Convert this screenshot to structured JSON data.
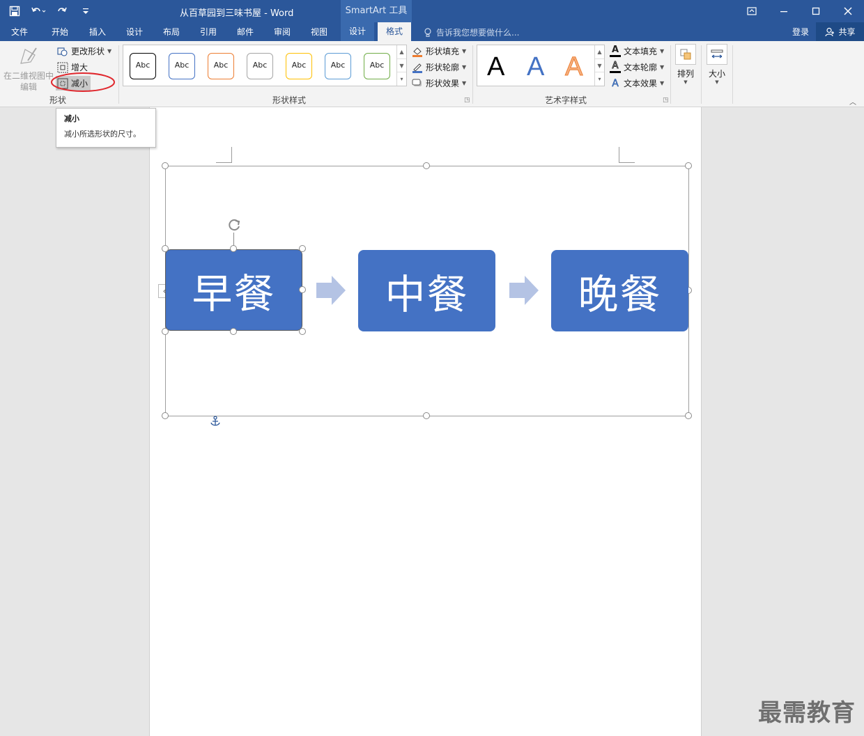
{
  "window": {
    "title": "从百草园到三味书屋 - Word",
    "context_tab_title": "SmartArt 工具"
  },
  "tabs": [
    {
      "label": "文件"
    },
    {
      "label": "开始"
    },
    {
      "label": "插入"
    },
    {
      "label": "设计"
    },
    {
      "label": "布局"
    },
    {
      "label": "引用"
    },
    {
      "label": "邮件"
    },
    {
      "label": "审阅"
    },
    {
      "label": "视图"
    },
    {
      "label": "设计"
    },
    {
      "label": "格式"
    }
  ],
  "tell_me": "告诉我您想要做什么...",
  "account": {
    "login": "登录",
    "share": "共享"
  },
  "ribbon": {
    "shapes_group": {
      "edit_2d_line1": "在二维视图中",
      "edit_2d_line2": "编辑",
      "change_shape": "更改形状",
      "larger": "增大",
      "smaller": "减小",
      "label": "形状"
    },
    "shape_styles_group": {
      "swatches": [
        "Abc",
        "Abc",
        "Abc",
        "Abc",
        "Abc",
        "Abc",
        "Abc"
      ],
      "swatch_colors": [
        "#000000",
        "#4472c4",
        "#ed7d31",
        "#a5a5a5",
        "#ffc000",
        "#5b9bd5",
        "#70ad47"
      ],
      "fill": "形状填充",
      "outline": "形状轮廓",
      "effects": "形状效果",
      "label": "形状样式"
    },
    "wordart_group": {
      "samples": [
        "A",
        "A",
        "A"
      ],
      "text_fill": "文本填充",
      "text_outline": "文本轮廓",
      "text_effects": "文本效果",
      "label": "艺术字样式"
    },
    "arrange": {
      "label": "排列"
    },
    "size": {
      "label": "大小"
    }
  },
  "tooltip": {
    "title": "减小",
    "description": "减小所选形状的尺寸。"
  },
  "smartart": {
    "nodes": [
      "早餐",
      "中餐",
      "晚餐"
    ],
    "node_color": "#4472c4",
    "arrow_color": "#b4c3e4"
  },
  "watermark": "最需教育",
  "colors": {
    "title_bar": "#2b579a",
    "highlight_ellipse": "#e0282e"
  }
}
